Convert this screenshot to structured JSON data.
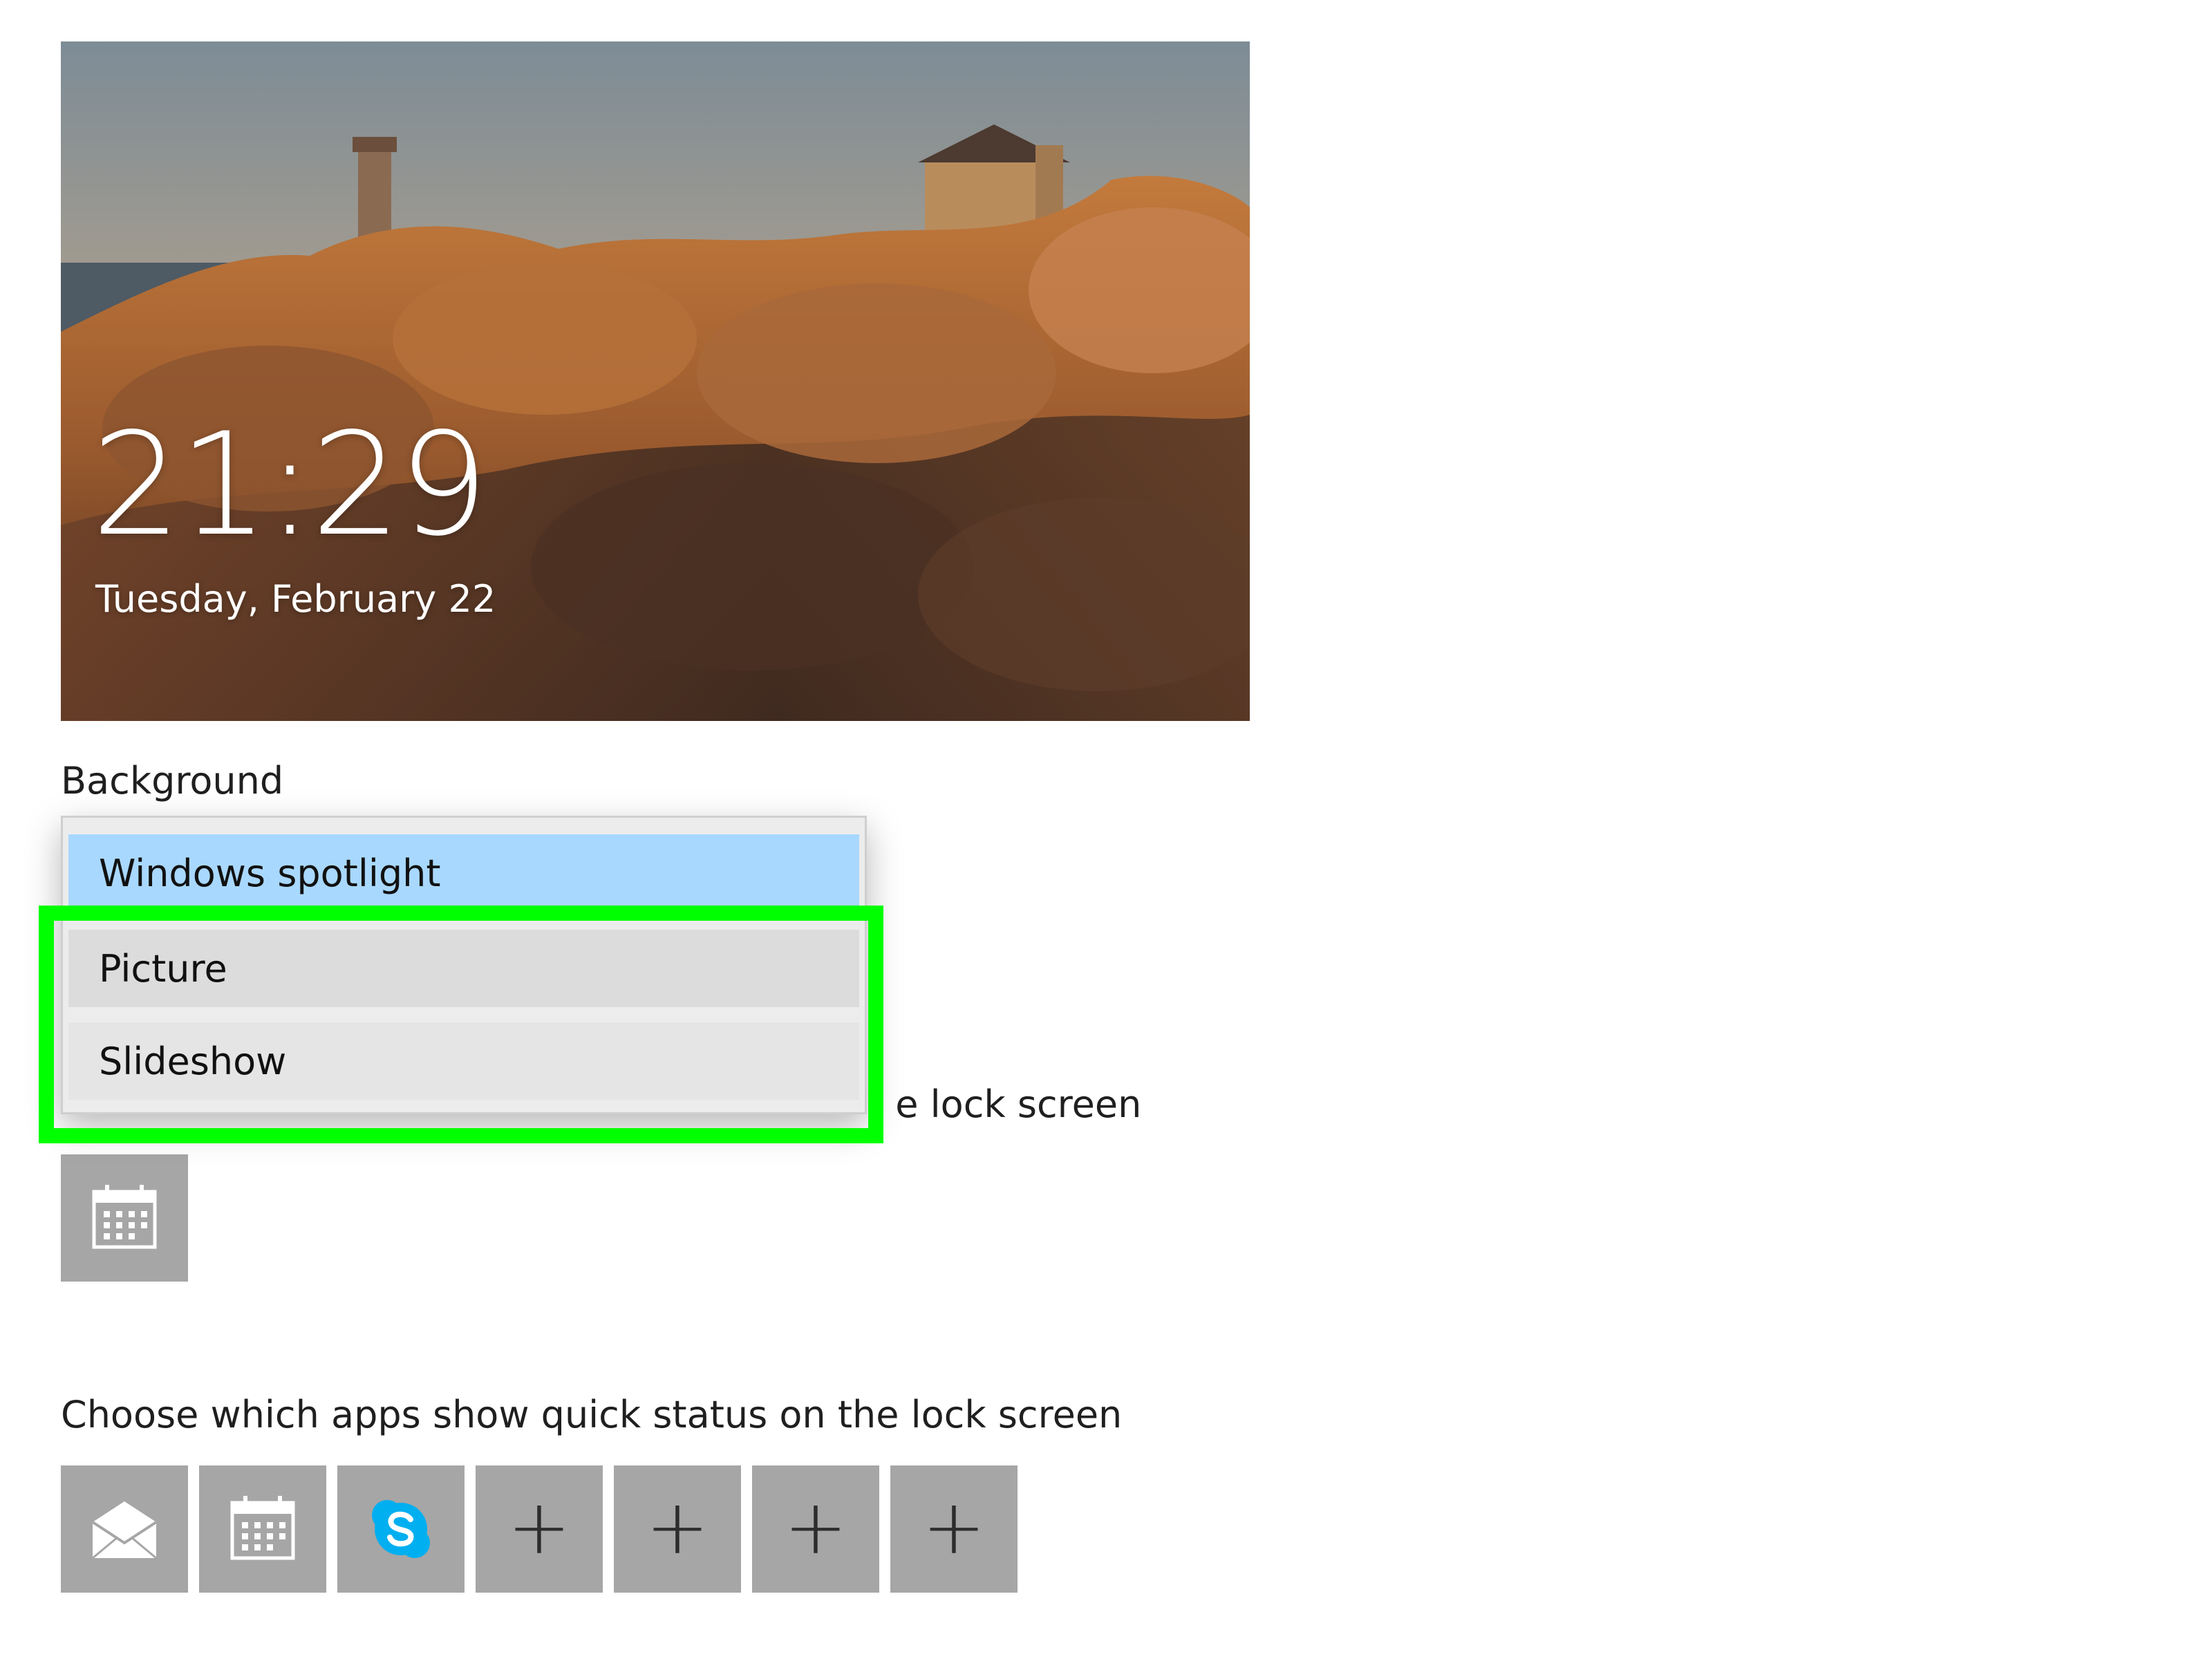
{
  "lock_screen": {
    "time": "21:29",
    "date": "Tuesday, February 22"
  },
  "background": {
    "label": "Background",
    "selected": "Windows spotlight",
    "options": [
      "Windows spotlight",
      "Picture",
      "Slideshow"
    ]
  },
  "detailed_status": {
    "label_visible_part": "e lock screen",
    "apps": [
      {
        "icon": "calendar-icon"
      }
    ]
  },
  "quick_status": {
    "label": "Choose which apps show quick status on the lock screen",
    "apps": [
      {
        "icon": "mail-icon"
      },
      {
        "icon": "calendar-icon"
      },
      {
        "icon": "skype-icon"
      },
      {
        "icon": "plus-icon",
        "glyph": "+"
      },
      {
        "icon": "plus-icon",
        "glyph": "+"
      },
      {
        "icon": "plus-icon",
        "glyph": "+"
      },
      {
        "icon": "plus-icon",
        "glyph": "+"
      }
    ]
  },
  "colors": {
    "selected_option": "#a9d8ff",
    "tile": "#a6a6a6",
    "highlight": "#00ff00",
    "skype": "#00aff0"
  }
}
